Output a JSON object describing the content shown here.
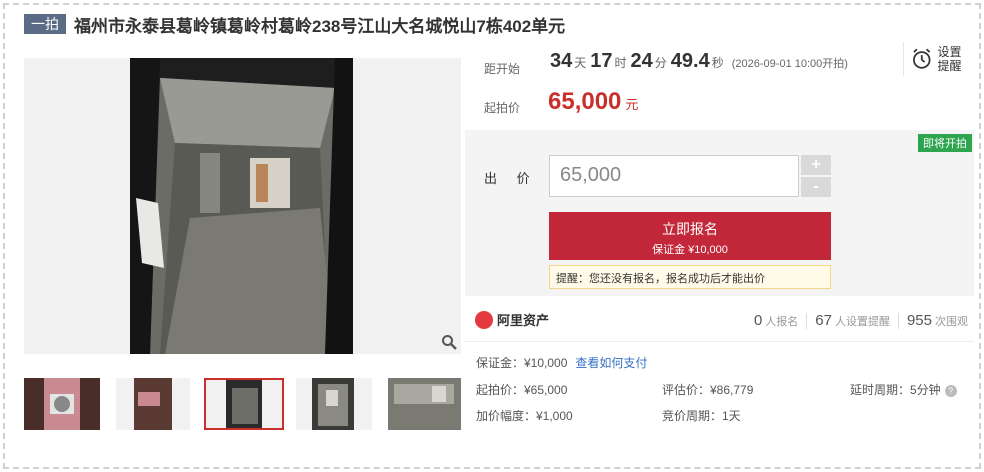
{
  "header": {
    "tag": "一拍",
    "title": "福州市永泰县葛岭镇葛岭村葛岭238号江山大名城悦山7栋402单元"
  },
  "countdown": {
    "label": "距开始",
    "days": "34",
    "days_unit": "天",
    "hours": "17",
    "hours_unit": "时",
    "minutes": "24",
    "minutes_unit": "分",
    "seconds": "49.4",
    "seconds_unit": "秒",
    "note": "(2026-09-01 10:00开拍)"
  },
  "start_price": {
    "label": "起拍价",
    "value": "65,000",
    "unit": "元"
  },
  "reminder": {
    "label": "设置提醒",
    "icon": "alarm-clock-icon"
  },
  "status_badge": "即将开拍",
  "bid": {
    "label": "出 价",
    "value": "65,000",
    "plus": "+",
    "minus": "-",
    "button_title": "立即报名",
    "button_sub": "保证金 ¥10,000",
    "tip": "提醒：您还没有报名，报名成功后才能出价"
  },
  "platform": {
    "name": "阿里资产"
  },
  "stats": [
    {
      "num": "0",
      "label": "人报名"
    },
    {
      "num": "67",
      "label": "人设置提醒"
    },
    {
      "num": "955",
      "label": "次围观"
    }
  ],
  "details": {
    "deposit_label": "保证金：¥10,000",
    "deposit_link": "查看如何支付",
    "start_price": "起拍价：¥65,000",
    "increment": "加价幅度：¥1,000",
    "valuation": "评估价：¥86,779",
    "bid_cycle": "竞价周期：1天",
    "delay_cycle": "延时周期：5分钟"
  },
  "colors": {
    "accent": "#c2283a",
    "tag": "#5b6b86",
    "badge": "#2ea44f",
    "link": "#3572c6"
  }
}
